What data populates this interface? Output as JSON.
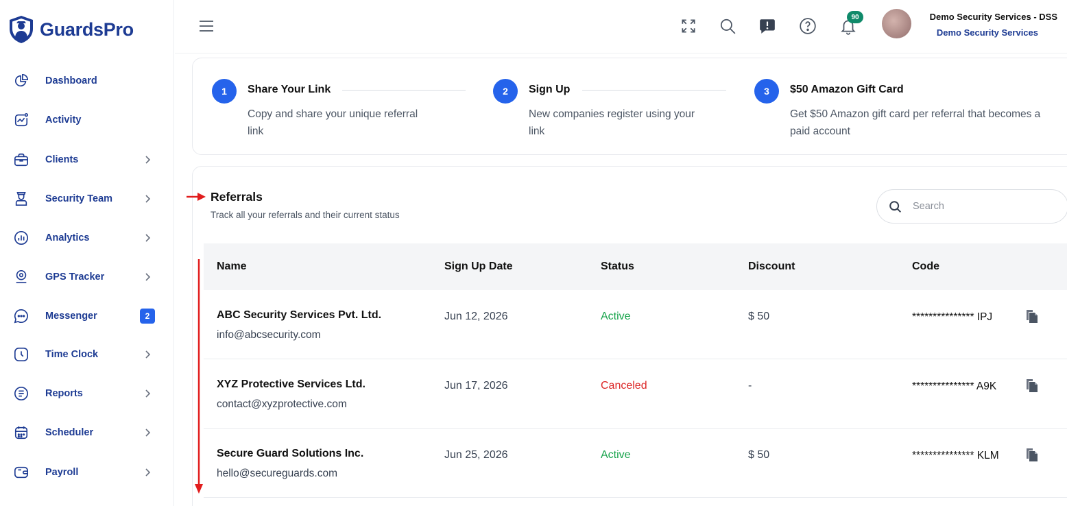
{
  "app": {
    "name": "GuardsPro"
  },
  "sidebar": {
    "items": [
      {
        "label": "Dashboard",
        "icon": "pie-chart-icon",
        "has_chevron": false
      },
      {
        "label": "Activity",
        "icon": "activity-icon",
        "has_chevron": false
      },
      {
        "label": "Clients",
        "icon": "briefcase-icon",
        "has_chevron": true
      },
      {
        "label": "Security Team",
        "icon": "guard-icon",
        "has_chevron": true
      },
      {
        "label": "Analytics",
        "icon": "bar-chart-icon",
        "has_chevron": true
      },
      {
        "label": "GPS Tracker",
        "icon": "location-pin-icon",
        "has_chevron": true
      },
      {
        "label": "Messenger",
        "icon": "chat-icon",
        "badge": "2"
      },
      {
        "label": "Time Clock",
        "icon": "clock-icon",
        "has_chevron": true
      },
      {
        "label": "Reports",
        "icon": "report-icon",
        "has_chevron": true
      },
      {
        "label": "Scheduler",
        "icon": "calendar-icon",
        "has_chevron": true
      },
      {
        "label": "Payroll",
        "icon": "wallet-icon",
        "has_chevron": true
      }
    ]
  },
  "topbar": {
    "notifications_count": "90",
    "user_name": "Demo Security Services - DSS",
    "user_company": "Demo Security Services"
  },
  "steps": [
    {
      "number": "1",
      "title": "Share Your Link",
      "description": "Copy and share your unique referral link"
    },
    {
      "number": "2",
      "title": "Sign Up",
      "description": "New companies register using your link"
    },
    {
      "number": "3",
      "title": "$50 Amazon Gift Card",
      "description": "Get $50 Amazon gift card per referral that becomes a paid account"
    }
  ],
  "referrals": {
    "title": "Referrals",
    "subtitle": "Track all your referrals and their current status",
    "search_placeholder": "Search",
    "columns": [
      "Name",
      "Sign Up Date",
      "Status",
      "Discount",
      "Code"
    ],
    "rows": [
      {
        "name": "ABC Security Services Pvt. Ltd.",
        "email": "info@abcsecurity.com",
        "date": "Jun 12, 2026",
        "status": "Active",
        "discount": "$ 50",
        "code": "*************** IPJ"
      },
      {
        "name": "XYZ Protective Services Ltd.",
        "email": "contact@xyzprotective.com",
        "date": "Jun 17, 2026",
        "status": "Canceled",
        "discount": "-",
        "code": "*************** A9K"
      },
      {
        "name": "Secure Guard Solutions Inc.",
        "email": "hello@secureguards.com",
        "date": "Jun 25, 2026",
        "status": "Active",
        "discount": "$ 50",
        "code": "*************** KLM"
      }
    ]
  },
  "colors": {
    "brand": "#1d3b93",
    "accent": "#2563eb",
    "active": "#16a34a",
    "canceled": "#dc2626",
    "annotation": "#e11d1d"
  }
}
